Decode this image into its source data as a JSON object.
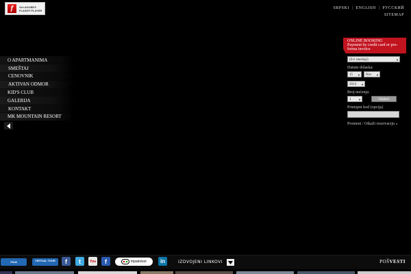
{
  "flash_badge": {
    "line1": "Get ADOBE®",
    "line2": "FLASH® PLAYER",
    "icon": "flash-icon"
  },
  "languages": [
    "SRPSKI",
    "ENGLISH",
    "РУССКИЙ"
  ],
  "sitemap": "SITEMAP",
  "nav": {
    "items": [
      {
        "label": "O APARTMANIMA"
      },
      {
        "label": "SMEŠTAJ"
      },
      {
        "label": "CENOVNIK"
      },
      {
        "label": "AKTIVAN ODMOR"
      },
      {
        "label": "KID'S CLUB"
      },
      {
        "label": "GALERIJA"
      },
      {
        "label": "KONTAKT"
      },
      {
        "label": "MK MOUNTAIN RESORT"
      }
    ],
    "back_icon": "chevron-left-icon"
  },
  "booking": {
    "title": "ONLINE BOOKING",
    "subtitle": "Payment by credit card or pro-forma invoice",
    "accommodation_select": "(Svi smeštaji)",
    "arrival_label": "Datum dolaska:",
    "day_select": "15",
    "month_select": "Nov",
    "year_select": "2014",
    "nights_label": "Broj noćenja:",
    "nights_select": "1",
    "submit_label": "Odaberi",
    "access_code_label": "Pristupni kod (opcija)",
    "access_code_value": "",
    "manage_link": "Promeni / Otkaži rezervaciju »",
    "accent_color": "#c2141f"
  },
  "bottom_bar": {
    "film_label": "FILM",
    "tour_label": "VIRTUAL TOUR",
    "facebook_icon": "facebook-icon",
    "twitter_icon": "twitter-icon",
    "youtube_label": "You",
    "facebook2_icon": "facebook-icon",
    "tripadvisor_label": "tripadvisor",
    "linkedin_label": "in",
    "links_label": "IZDVOJENI LINKOVI",
    "links_toggle_icon": "chevron-down-icon",
    "news_prefix": "POŠ",
    "news_bold": "VESTI"
  }
}
